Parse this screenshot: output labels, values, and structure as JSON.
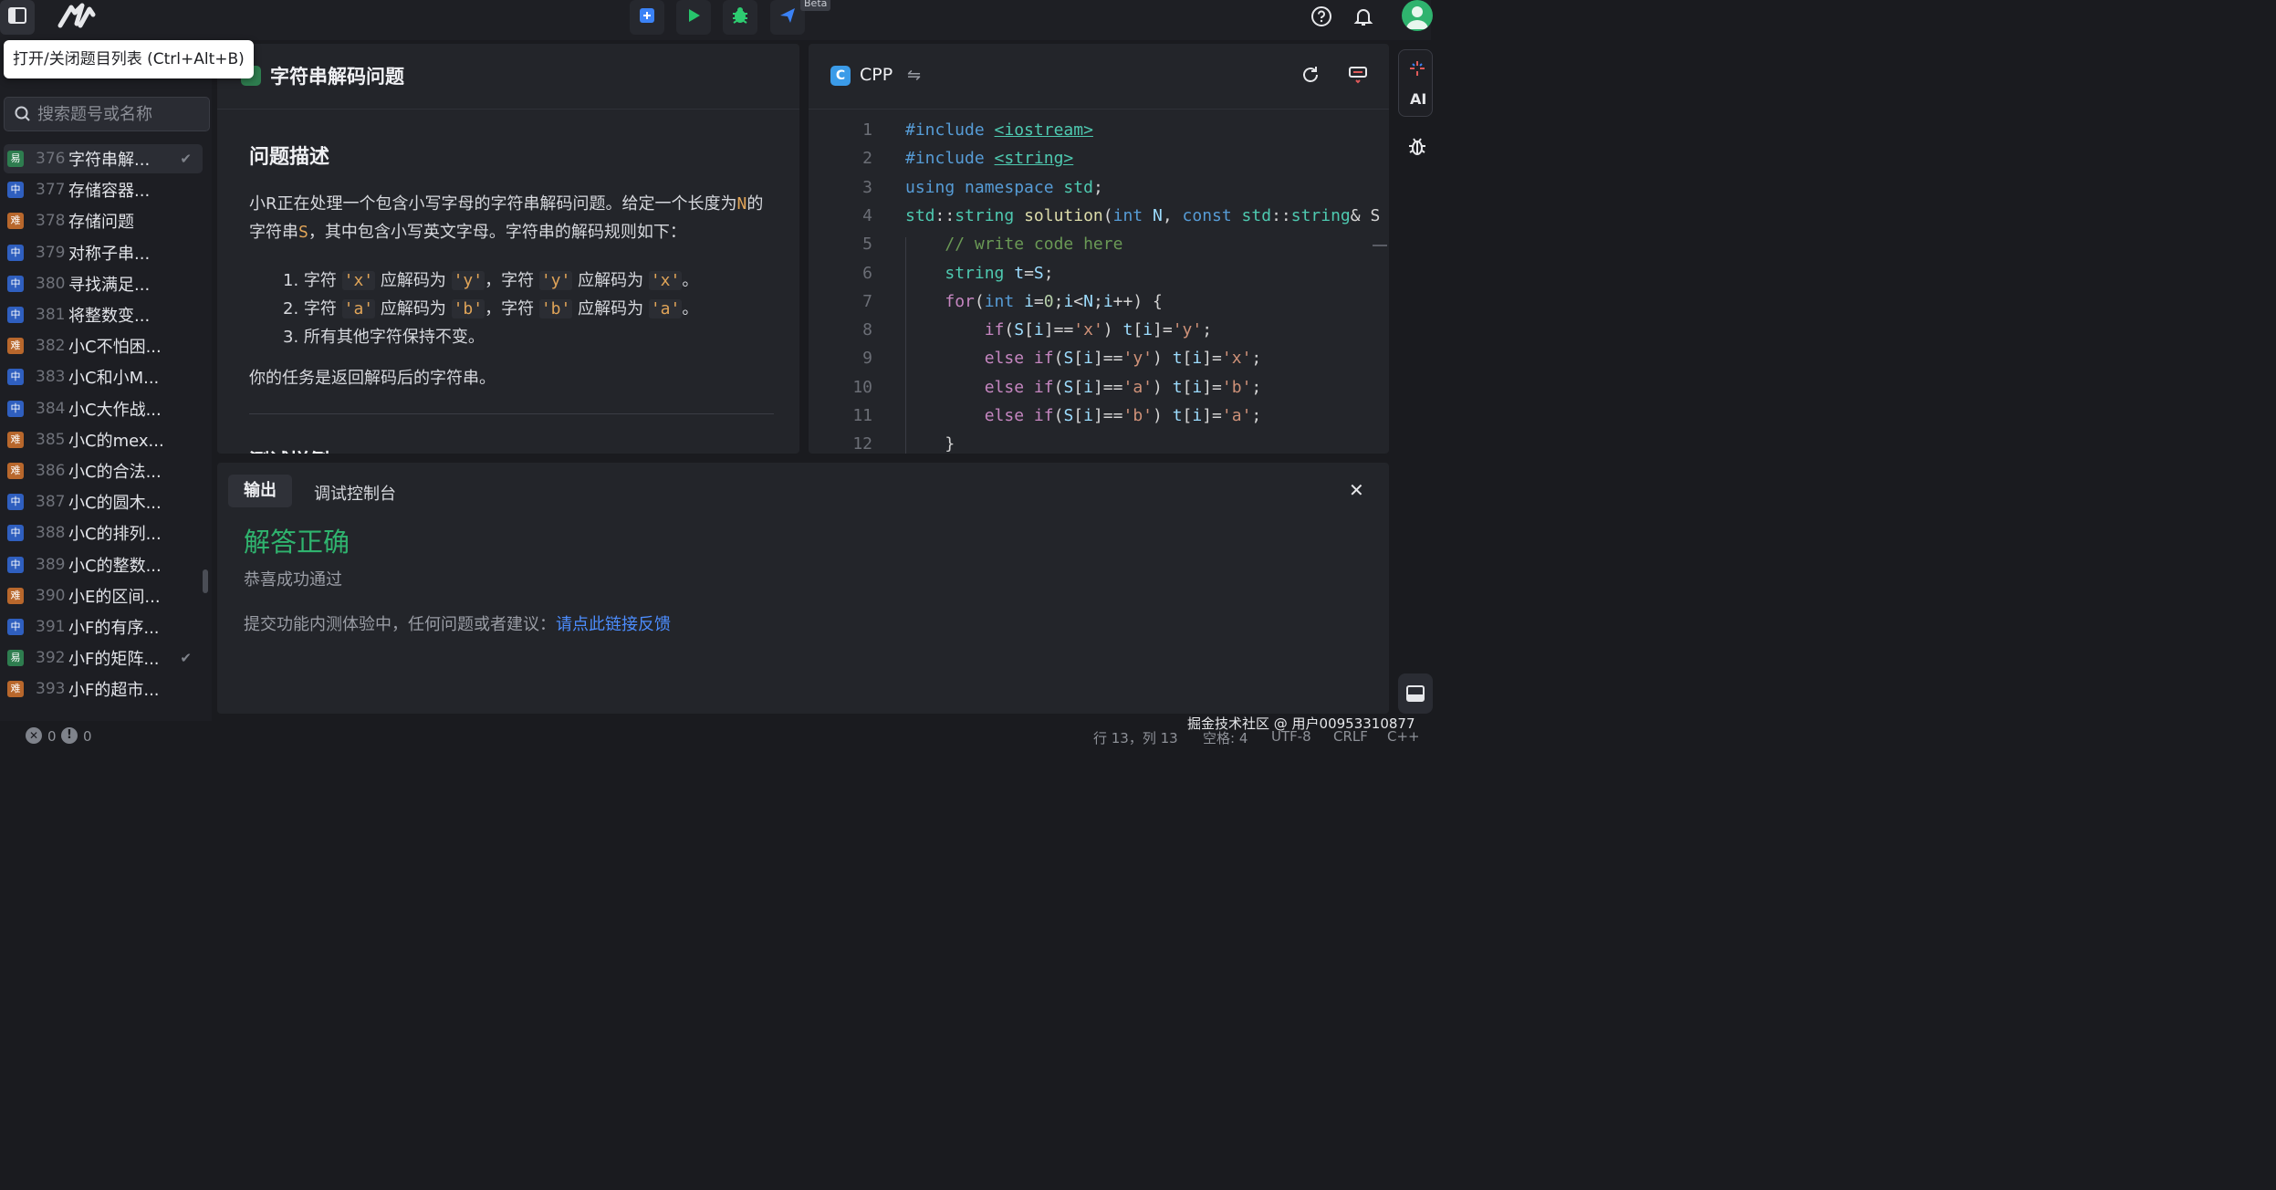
{
  "colors": {
    "accent_blue": "#3b82f6",
    "run_green": "#27c46b",
    "debug_green": "#2ecc71",
    "easy": "#2e7d4f",
    "medium": "#2f5fbf",
    "hard": "#b8672c",
    "success": "#2fb36e",
    "link": "#4c8dff"
  },
  "topbar": {
    "beta_badge": "Beta",
    "icons": [
      "sidebar-toggle-icon",
      "logo-icon",
      "submit-icon",
      "run-icon",
      "debug-icon",
      "send-icon",
      "help-icon",
      "bell-icon",
      "avatar-icon"
    ]
  },
  "tooltip": "打开/关闭题目列表 (Ctrl+Alt+B)",
  "sidebar": {
    "search_placeholder": "搜索题号或名称",
    "problems": [
      {
        "num": "376",
        "title": "字符串解...",
        "diff": "易",
        "level": "easy",
        "checked": true,
        "selected": true
      },
      {
        "num": "377",
        "title": "存储容器...",
        "diff": "中",
        "level": "medium"
      },
      {
        "num": "378",
        "title": "存储问题",
        "diff": "难",
        "level": "hard"
      },
      {
        "num": "379",
        "title": "对称子串...",
        "diff": "中",
        "level": "medium"
      },
      {
        "num": "380",
        "title": "寻找满足...",
        "diff": "中",
        "level": "medium"
      },
      {
        "num": "381",
        "title": "将整数变...",
        "diff": "中",
        "level": "medium"
      },
      {
        "num": "382",
        "title": "小C不怕困...",
        "diff": "难",
        "level": "hard"
      },
      {
        "num": "383",
        "title": "小C和小M...",
        "diff": "中",
        "level": "medium"
      },
      {
        "num": "384",
        "title": "小C大作战...",
        "diff": "中",
        "level": "medium"
      },
      {
        "num": "385",
        "title": "小C的mex...",
        "diff": "难",
        "level": "hard"
      },
      {
        "num": "386",
        "title": "小C的合法...",
        "diff": "难",
        "level": "hard"
      },
      {
        "num": "387",
        "title": "小C的圆木...",
        "diff": "中",
        "level": "medium"
      },
      {
        "num": "388",
        "title": "小C的排列...",
        "diff": "中",
        "level": "medium"
      },
      {
        "num": "389",
        "title": "小C的整数...",
        "diff": "中",
        "level": "medium"
      },
      {
        "num": "390",
        "title": "小E的区间...",
        "diff": "难",
        "level": "hard"
      },
      {
        "num": "391",
        "title": "小F的有序...",
        "diff": "中",
        "level": "medium"
      },
      {
        "num": "392",
        "title": "小F的矩阵...",
        "diff": "易",
        "level": "easy",
        "checked": true
      },
      {
        "num": "393",
        "title": "小F的超市...",
        "diff": "难",
        "level": "hard"
      }
    ]
  },
  "description": {
    "title": "字符串解码问题",
    "section": "问题描述",
    "para1_a": "小R正在处理一个包含小写字母的字符串解码问题。给定一个长度为",
    "para1_var_n": "N",
    "para1_b": "的字符串",
    "para1_var_s": "S",
    "para1_c": "，其中包含小写英文字母。字符串的解码规则如下：",
    "rules": [
      {
        "prefix": "1. 字符 ",
        "c1": "'x'",
        "mid1": " 应解码为 ",
        "c2": "'y'",
        "mid2": "，字符 ",
        "c3": "'y'",
        "mid3": " 应解码为 ",
        "c4": "'x'",
        "suffix": "。"
      },
      {
        "prefix": "2. 字符 ",
        "c1": "'a'",
        "mid1": " 应解码为 ",
        "c2": "'b'",
        "mid2": "，字符 ",
        "c3": "'b'",
        "mid3": " 应解码为 ",
        "c4": "'a'",
        "suffix": "。"
      }
    ],
    "rule3": "3. 所有其他字符保持不变。",
    "task": "你的任务是返回解码后的字符串。",
    "next_section_partial": "测试样例"
  },
  "editor": {
    "language": "CPP",
    "lines": [
      {
        "n": "1",
        "html": "<span style='color:#569cd6'>#include</span> <span style='color:#4ec9b0;text-decoration:underline'>&lt;iostream&gt;</span>"
      },
      {
        "n": "2",
        "html": "<span style='color:#569cd6'>#include</span> <span style='color:#4ec9b0;text-decoration:underline'>&lt;string&gt;</span>"
      },
      {
        "n": "3",
        "html": "<span style='color:#569cd6'>using</span> <span style='color:#569cd6'>namespace</span> <span style='color:#4ec9b0'>std</span>;"
      },
      {
        "n": "4",
        "html": "<span style='color:#4ec9b0'>std</span>::<span style='color:#4ec9b0'>string</span> <span style='color:#dcdcaa'>solution</span>(<span style='color:#569cd6'>int</span> <span style='color:#9cdcfe'>N</span>, <span style='color:#569cd6'>const</span> <span style='color:#4ec9b0'>std</span>::<span style='color:#4ec9b0'>string</span>&amp; S"
      },
      {
        "n": "5",
        "html": "    <span style='color:#6a9955'>// write code here</span>"
      },
      {
        "n": "6",
        "html": "    <span style='color:#4ec9b0'>string</span> <span style='color:#9cdcfe'>t</span>=<span style='color:#9cdcfe'>S</span>;"
      },
      {
        "n": "7",
        "html": "    <span style='color:#c586c0'>for</span>(<span style='color:#569cd6'>int</span> <span style='color:#9cdcfe'>i</span>=<span style='color:#b5cea8'>0</span>;<span style='color:#9cdcfe'>i</span>&lt;<span style='color:#9cdcfe'>N</span>;<span style='color:#9cdcfe'>i</span>++) {"
      },
      {
        "n": "8",
        "html": "        <span style='color:#c586c0'>if</span>(<span style='color:#9cdcfe'>S</span>[<span style='color:#9cdcfe'>i</span>]==<span style='color:#ce9178'>'x'</span>) <span style='color:#9cdcfe'>t</span>[<span style='color:#9cdcfe'>i</span>]=<span style='color:#ce9178'>'y'</span>;"
      },
      {
        "n": "9",
        "html": "        <span style='color:#c586c0'>else</span> <span style='color:#c586c0'>if</span>(<span style='color:#9cdcfe'>S</span>[<span style='color:#9cdcfe'>i</span>]==<span style='color:#ce9178'>'y'</span>) <span style='color:#9cdcfe'>t</span>[<span style='color:#9cdcfe'>i</span>]=<span style='color:#ce9178'>'x'</span>;"
      },
      {
        "n": "10",
        "html": "        <span style='color:#c586c0'>else</span> <span style='color:#c586c0'>if</span>(<span style='color:#9cdcfe'>S</span>[<span style='color:#9cdcfe'>i</span>]==<span style='color:#ce9178'>'a'</span>) <span style='color:#9cdcfe'>t</span>[<span style='color:#9cdcfe'>i</span>]=<span style='color:#ce9178'>'b'</span>;"
      },
      {
        "n": "11",
        "html": "        <span style='color:#c586c0'>else</span> <span style='color:#c586c0'>if</span>(<span style='color:#9cdcfe'>S</span>[<span style='color:#9cdcfe'>i</span>]==<span style='color:#ce9178'>'b'</span>) <span style='color:#9cdcfe'>t</span>[<span style='color:#9cdcfe'>i</span>]=<span style='color:#ce9178'>'a'</span>;"
      },
      {
        "n": "12",
        "html": "    }"
      }
    ]
  },
  "output": {
    "tabs": [
      "输出",
      "调试控制台"
    ],
    "result_title": "解答正确",
    "result_sub": "恭喜成功通过",
    "feedback_text": "提交功能内测体验中，任何问题或者建议：",
    "feedback_link": "请点此链接反馈"
  },
  "rightbar": {
    "ai_label": "AI"
  },
  "statusbar": {
    "errors": "0",
    "warnings": "0",
    "position": "行 13，列 13",
    "spaces": "空格: 4",
    "encoding": "UTF-8",
    "eol": "CRLF",
    "language": "C++",
    "watermark": "掘金技术社区 @ 用户00953310877"
  }
}
